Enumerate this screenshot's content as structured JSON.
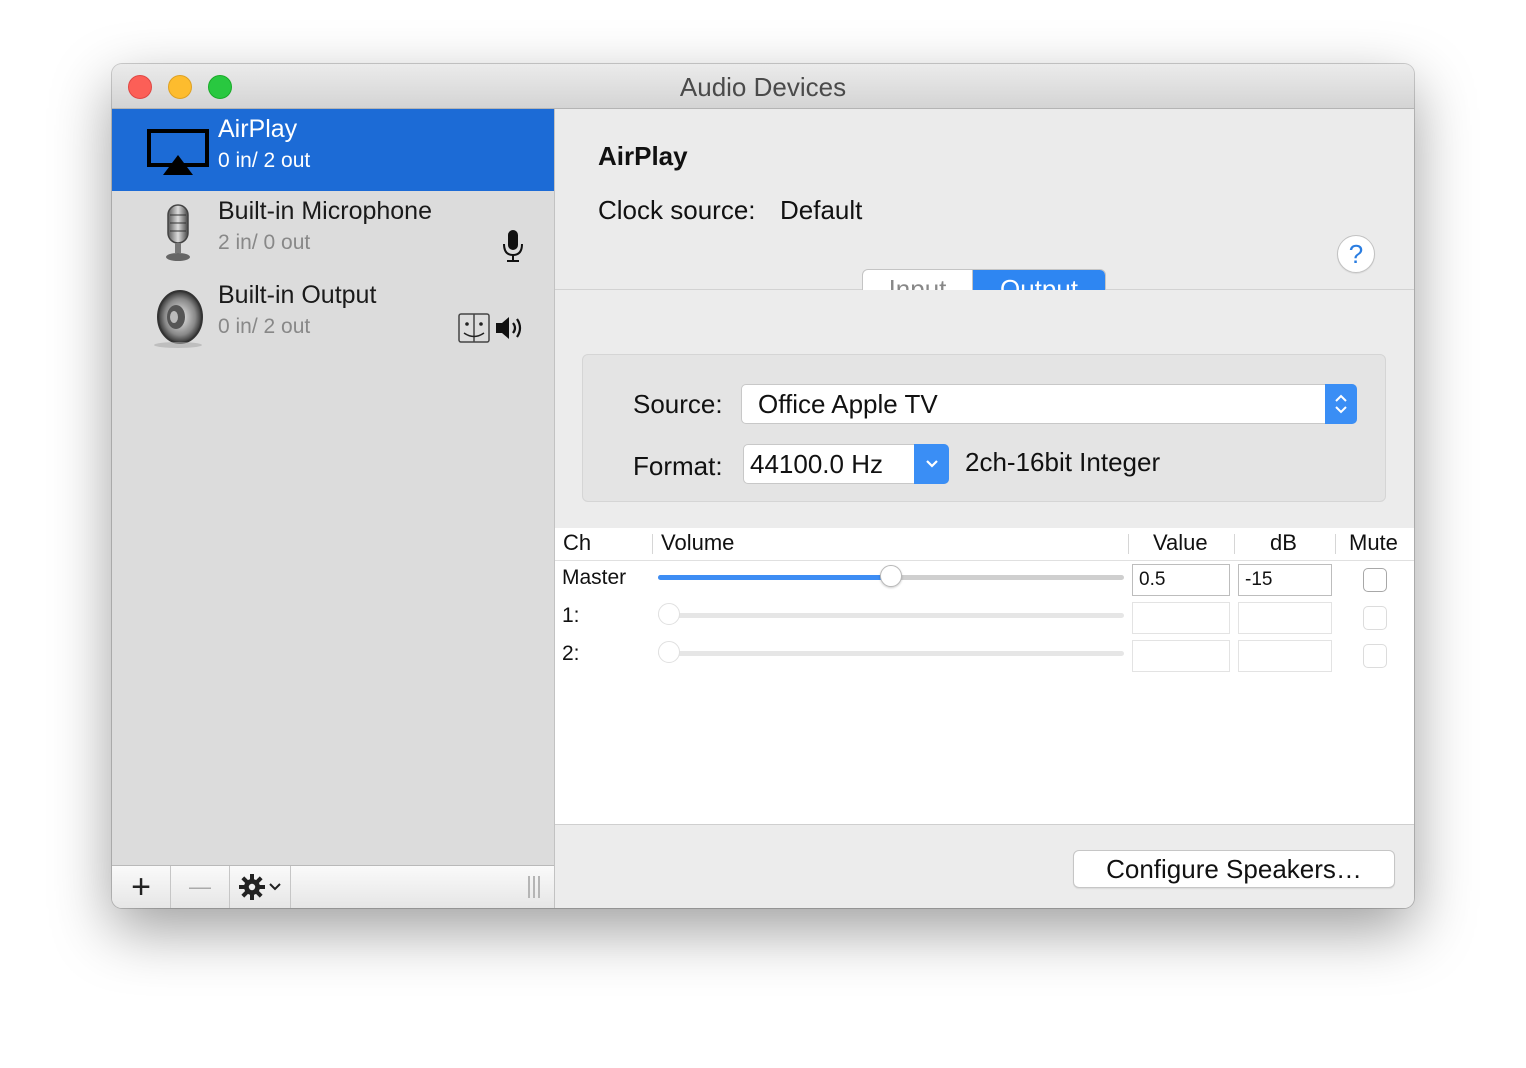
{
  "window": {
    "title": "Audio Devices"
  },
  "sidebar": {
    "devices": [
      {
        "name": "AirPlay",
        "io": "0 in/ 2 out",
        "icon": "airplay-icon",
        "selected": true
      },
      {
        "name": "Built-in Microphone",
        "io": "2 in/ 0 out",
        "icon": "microphone-icon",
        "status_icons": [
          "default-input-mic-icon"
        ]
      },
      {
        "name": "Built-in Output",
        "io": "0 in/ 2 out",
        "icon": "speaker-icon",
        "status_icons": [
          "system-output-finder-icon",
          "default-output-speaker-icon"
        ]
      }
    ],
    "footer": {
      "add": "+",
      "remove": "—",
      "action_icon": "gear-icon"
    }
  },
  "detail": {
    "device_title": "AirPlay",
    "clock_label": "Clock source:",
    "clock_value": "Default",
    "help": "?",
    "tabs": {
      "input": "Input",
      "output": "Output",
      "selected": "Output"
    },
    "source_label": "Source:",
    "source_value": "Office Apple TV",
    "format_label": "Format:",
    "format_value": "44100.0 Hz",
    "format_desc": "2ch-16bit Integer"
  },
  "channels": {
    "headers": {
      "ch": "Ch",
      "volume": "Volume",
      "value": "Value",
      "db": "dB",
      "mute": "Mute"
    },
    "rows": [
      {
        "label": "Master",
        "volume": 0.5,
        "value": "0.5",
        "db": "-15",
        "enabled": true
      },
      {
        "label": "1:",
        "volume": 0,
        "value": "",
        "db": "",
        "enabled": false
      },
      {
        "label": "2:",
        "volume": 0,
        "value": "",
        "db": "",
        "enabled": false
      }
    ]
  },
  "footer": {
    "configure": "Configure Speakers…"
  },
  "colors": {
    "accent": "#2e86f2",
    "selection": "#1c6bd6"
  }
}
